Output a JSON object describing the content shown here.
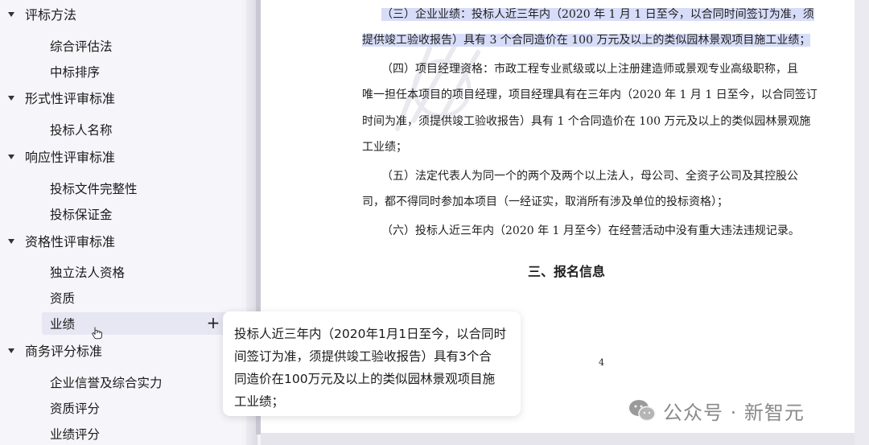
{
  "sidebar": {
    "sections": [
      {
        "label": "评标方法",
        "items": [
          "综合评估法",
          "中标排序"
        ]
      },
      {
        "label": "形式性评审标准",
        "items": [
          "投标人名称"
        ]
      },
      {
        "label": "响应性评审标准",
        "items": [
          "投标文件完整性",
          "投标保证金"
        ]
      },
      {
        "label": "资格性评审标准",
        "items": [
          "独立法人资格",
          "资质",
          "业绩"
        ]
      },
      {
        "label": "商务评分标准",
        "items": [
          "企业信誉及综合实力",
          "资质评分",
          "业绩评分"
        ]
      }
    ],
    "add_icon": "plus-icon"
  },
  "document": {
    "lines": [
      "（三）企业业绩：投标人近三年内（2020 年 1 月 1 日至今，以合同时间签订为准，须",
      "提供竣工验收报告）具有 3 个合同造价在 100 万元及以上的类似园林景观项目施工业绩；",
      "（四）项目经理资格：市政工程专业贰级或以上注册建造师或景观专业高级职称，且",
      "唯一担任本项目的项目经理，项目经理具有在三年内（2020 年 1 月 1 日至今，以合同签订",
      "时间为准，须提供竣工验收报告）具有 1 个合同造价在 100 万元及以上的类似园林景观施",
      "工业绩；",
      "（五）法定代表人为同一个的两个及两个以上法人，母公司、全资子公司及其控股公",
      "司，都不得同时参加本项目（一经证实，取消所有涉及单位的投标资格）；",
      "（六）投标人近三年内（2020 年 1 月至今）在经营活动中没有重大违法违规记录。"
    ],
    "heading": "三、报名信息",
    "page_number": "4"
  },
  "tooltip": {
    "lines": [
      "投标人近三年内（2020年1月1日至今，以合同时",
      "间签订为准，须提供竣工验收报告）具有3个合",
      "同造价在100万元及以上的类似园林景观项目施",
      "工业绩；"
    ]
  },
  "brand": {
    "text": "公众号 · 新智元",
    "icon": "wechat-icon"
  }
}
